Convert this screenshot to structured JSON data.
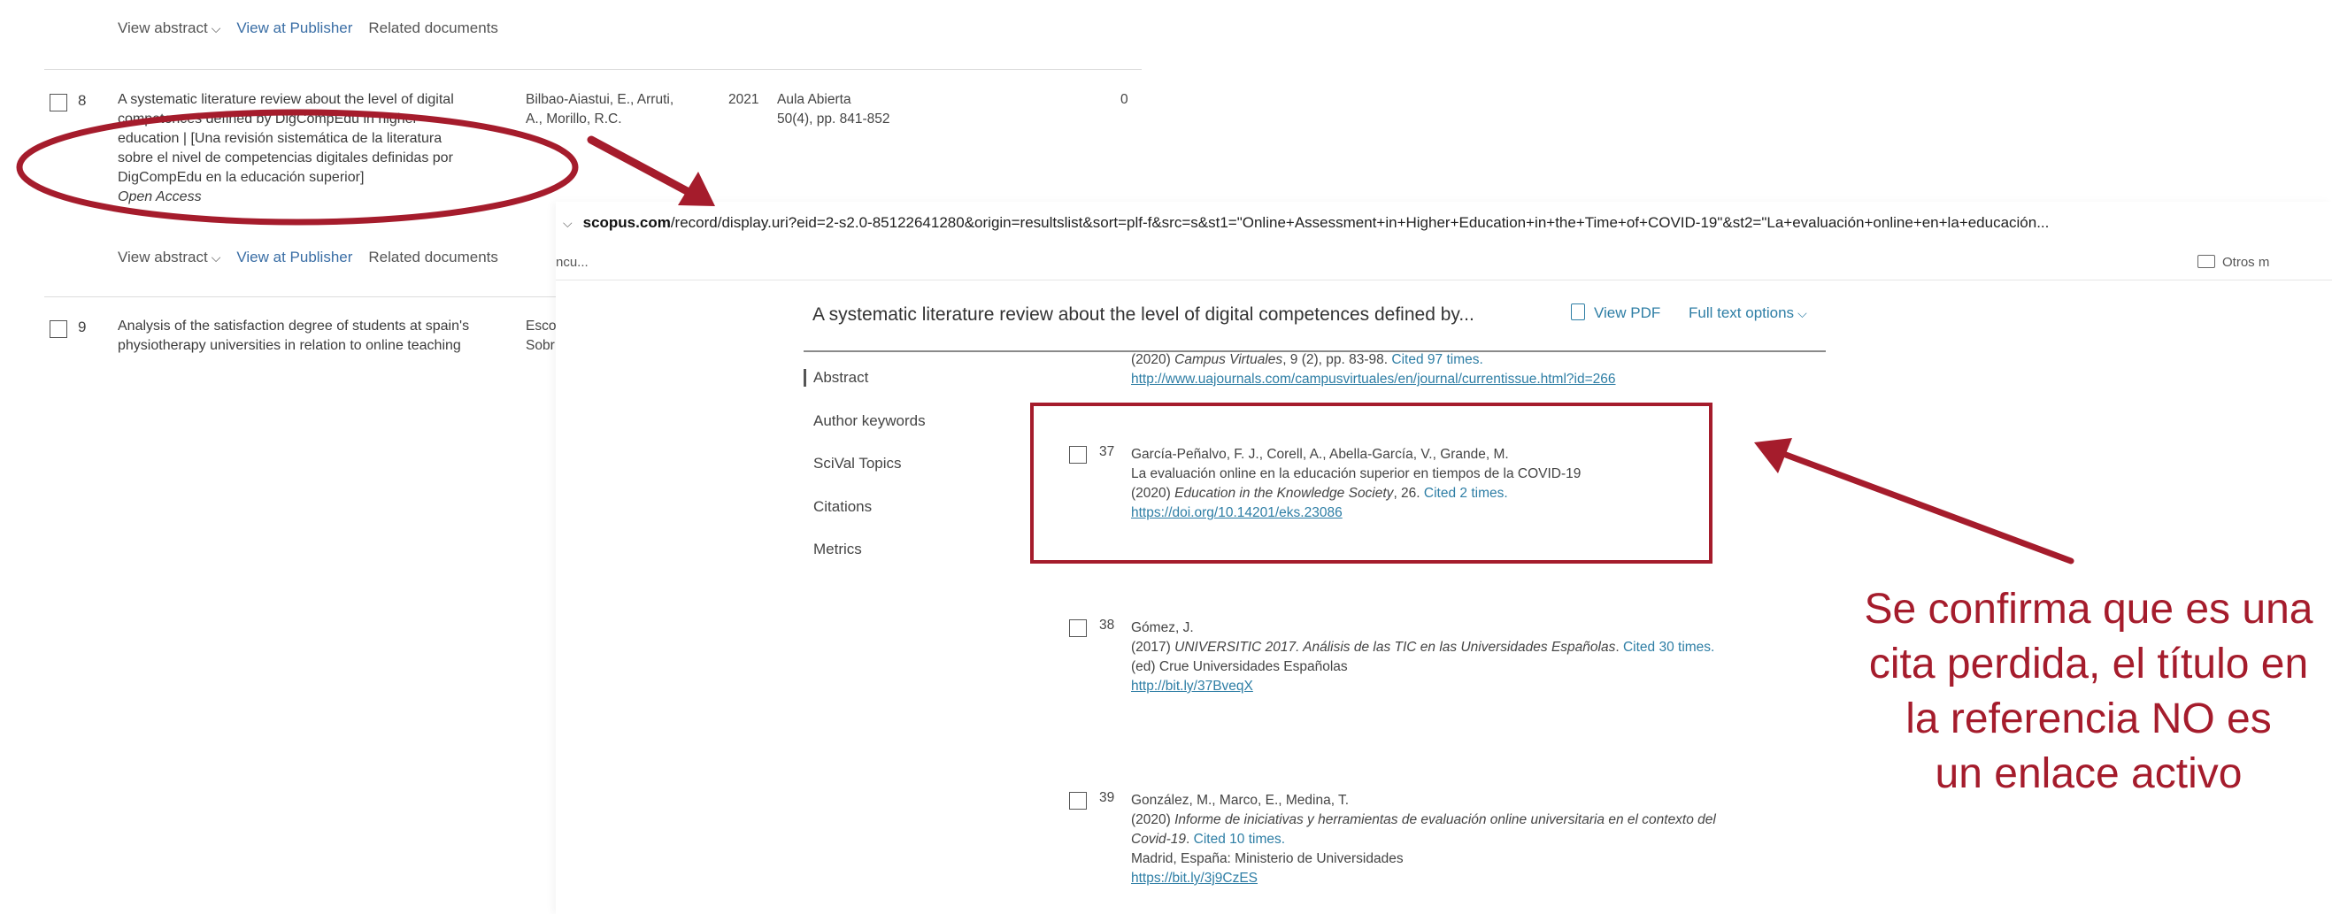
{
  "colors": {
    "annotation": "#a51c2c",
    "link": "#2e7ea5",
    "publisher_link": "#3a6ea5"
  },
  "results": {
    "top_actions": {
      "view_abstract": "View abstract",
      "view_publisher": "View at Publisher",
      "related": "Related documents"
    },
    "item8": {
      "num": "8",
      "title": [
        "A systematic literature review about the level of digital",
        "competences defined by DigCompEdu in higher",
        "education | [Una revisión sistemática de la literatura",
        "sobre el nivel de competencias digitales definidas por",
        "DigCompEdu en la educación superior]"
      ],
      "open_access": "Open Access",
      "authors": [
        "Bilbao-Aiastui, E., Arruti,",
        "A., Morillo, R.C."
      ],
      "year": "2021",
      "source": [
        "Aula Abierta",
        "50(4), pp. 841-852"
      ],
      "cited": "0"
    },
    "item8_actions": {
      "view_abstract": "View abstract",
      "view_publisher": "View at Publisher",
      "related": "Related documents"
    },
    "item9": {
      "num": "9",
      "title": [
        "Analysis of the satisfaction degree of students at spain's",
        "physiotherapy universities in relation to online teaching"
      ],
      "authors": [
        "Esco",
        "Sobr"
      ]
    }
  },
  "browser": {
    "url_host": "scopus.com",
    "url_path": "/record/display.uri?eid=2-s2.0-85122641280&origin=resultslist&sort=plf-f&src=s&st1=\"Online+Assessment+in+Higher+Education+in+the+Time+of+COVID-19\"&st2=\"La+evaluación+online+en+la+educación...",
    "bookmark_left": "ncu...",
    "bookmark_right": "Otros m"
  },
  "record": {
    "title": "A systematic literature review about the level of digital competences defined by...",
    "view_pdf": "View PDF",
    "full_text_options": "Full text options",
    "nav": [
      "Abstract",
      "Author keywords",
      "SciVal Topics",
      "Citations",
      "Metrics"
    ],
    "ref_prev": {
      "line1_pre": "(2020) ",
      "line1_journal": "Campus Virtuales",
      "line1_post": ", 9 (2), pp. 83-98. ",
      "line1_cited": "Cited 97 times.",
      "url": "http://www.uajournals.com/campusvirtuales/en/journal/currentissue.html?id=266"
    },
    "ref37": {
      "num": "37",
      "authors": "García-Peñalvo, F. J., Corell, A., Abella-García, V., Grande, M.",
      "title": "La evaluación online en la educación superior en tiempos de la COVID-19",
      "line3_pre": "(2020) ",
      "line3_journal": "Education in the Knowledge Society",
      "line3_post": ", 26. ",
      "line3_cited": "Cited 2 times.",
      "doi": "https://doi.org/10.14201/eks.23086"
    },
    "ref38": {
      "num": "38",
      "authors": "Gómez, J.",
      "line2_pre": "(2017) ",
      "line2_title": "UNIVERSITIC 2017. Análisis de las TIC en las Universidades Españolas",
      "line2_post": ". ",
      "line2_cited": "Cited 30 times.",
      "line3": "(ed) Crue Universidades Españolas",
      "url": "http://bit.ly/37BveqX"
    },
    "ref39": {
      "num": "39",
      "authors": "González, M., Marco, E., Medina, T.",
      "line2_pre": "(2020) ",
      "line2_title": "Informe de iniciativas y herramientas de evaluación online universitaria en el contexto del",
      "line3_title": "Covid-19",
      "line3_post": ". ",
      "line3_cited": "Cited 10 times.",
      "line4": "Madrid, España: Ministerio de Universidades",
      "url": "https://bit.ly/3j9CzES"
    }
  },
  "annotation": {
    "lines": [
      "Se confirma que es una",
      "cita perdida, el título en",
      "la referencia NO es",
      "un enlace activo"
    ]
  }
}
